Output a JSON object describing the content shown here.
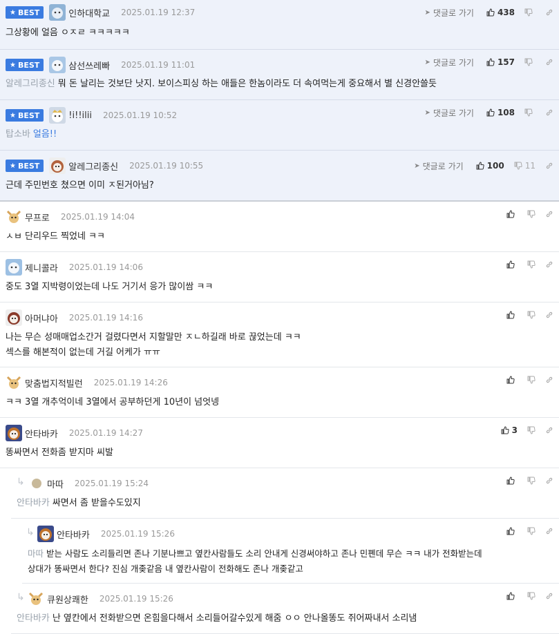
{
  "best_label": "BEST",
  "reply_link_label": "댓글로 가기",
  "best_comments": [
    {
      "nick": "인하대학교",
      "date": "2025.01.19 12:37",
      "body_mention": "",
      "body": "그상황에 얼음 ㅇㅈㄹ ㅋㅋㅋㅋㅋ",
      "likes": "438",
      "dislikes": ""
    },
    {
      "nick": "삼선쓰레빠",
      "date": "2025.01.19 11:01",
      "body_mention": "알레그리종신",
      "body": "뭐 돈 날리는 것보단 낫지. 보이스피싱 하는 애들은 한놈이라도 더 속여먹는게 중요해서 별 신경안쓸듯",
      "likes": "157",
      "dislikes": ""
    },
    {
      "nick": "!i!!ilii",
      "date": "2025.01.19 10:52",
      "body_mention": "탑소바",
      "body": "얼음!!",
      "likes": "108",
      "dislikes": ""
    },
    {
      "nick": "알레그리종신",
      "date": "2025.01.19 10:55",
      "body_mention": "",
      "body": "근데 주민번호 쳤으면 이미 ㅈ된거아님?",
      "likes": "100",
      "dislikes": "11"
    }
  ],
  "comments": [
    {
      "nick": "무프로",
      "date": "2025.01.19 14:04",
      "mention": "",
      "lines": [
        "ㅅㅂ 단리우드 찍었네 ㅋㅋ"
      ],
      "likes": ""
    },
    {
      "nick": "제니콜라",
      "date": "2025.01.19 14:06",
      "mention": "",
      "lines": [
        "중도 3열 지박령이었는데 나도 거기서 응가 많이쌈 ㅋㅋ"
      ],
      "likes": ""
    },
    {
      "nick": "아머냐아",
      "date": "2025.01.19 14:16",
      "mention": "",
      "lines": [
        "나는 무슨 성매매업소간거 걸렸다면서 지할말만 ㅈㄴ하길래 바로 끊었는데 ㅋㅋ",
        "섹스를 해본적이 없는데 거길 어케가 ㅠㅠ"
      ],
      "likes": ""
    },
    {
      "nick": "맞춤법지적빌런",
      "date": "2025.01.19 14:26",
      "mention": "",
      "lines": [
        "ㅋㅋ 3열 개추억이네 3열에서 공부하던게 10년이 넘엇넹"
      ],
      "likes": ""
    },
    {
      "nick": "안타바카",
      "date": "2025.01.19 14:27",
      "mention": "",
      "lines": [
        "똥싸면서 전화좀 받지마 씨발"
      ],
      "likes": "3"
    },
    {
      "nick": "마따",
      "date": "2025.01.19 15:24",
      "mention": "안타바카",
      "lines": [
        "싸면서 좀 받을수도있지"
      ],
      "likes": ""
    },
    {
      "nick": "안타바카",
      "date": "2025.01.19 15:26",
      "mention": "마따",
      "lines": [
        "받는 사람도 소리들리면 존나 기분나쁘고 옆칸사람들도 소리 안내게 신경써야하고 존나 민폔데 무슨 ㅋㅋ 내가 전화받는데",
        "상대가 똥싸면서 한다? 진심 개좆같음 내 옆칸사람이 전화해도 존나 개좆같고"
      ],
      "likes": ""
    },
    {
      "nick": "큐원상쾌한",
      "date": "2025.01.19 15:26",
      "mention": "안타바카",
      "lines": [
        "난 옆칸에서 전화받으면 온힘을다해서 소리들어갈수있게 해줌 ㅇㅇ 안나올똥도 쥐어짜내서 소리냄"
      ],
      "likes": ""
    }
  ],
  "colors": {
    "accent": "#3a7be0",
    "best_bg": "#eef2fa",
    "meta": "#999999",
    "mention": "#9aa3ad"
  }
}
